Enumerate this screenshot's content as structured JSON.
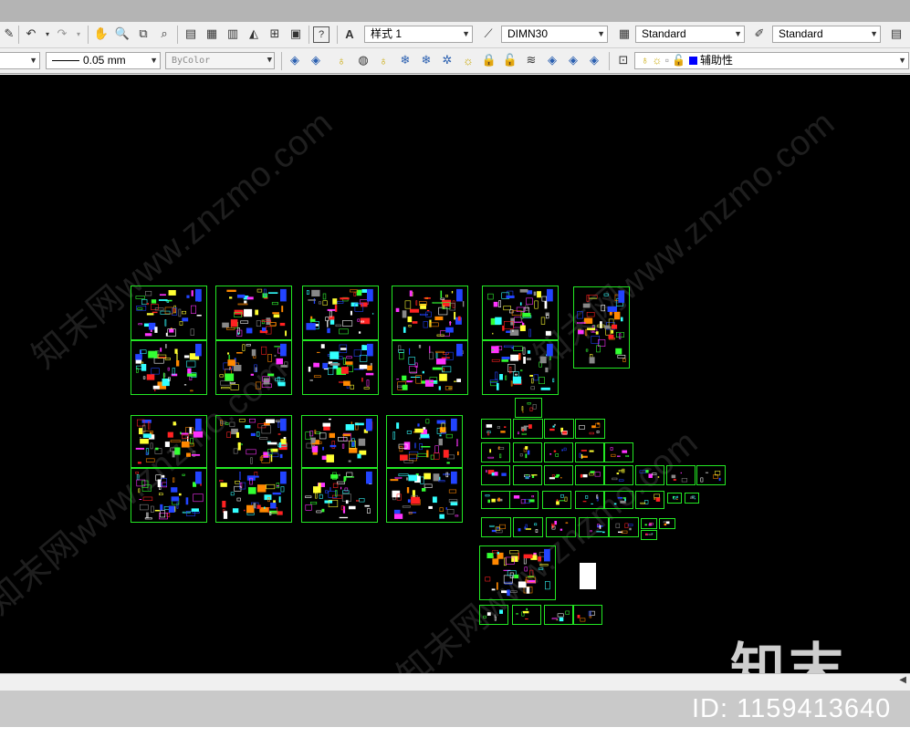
{
  "toolbar1": {
    "text_style": "样式 1",
    "dim_style": "DIMN30",
    "table_style": "Standard",
    "mleader_style": "Standard"
  },
  "toolbar2": {
    "lineweight": "0.05 mm",
    "plotstyle": "ByColor",
    "layer_name": "辅助性",
    "layer_color": "#0000ff"
  },
  "canvas": {
    "background": "#000000",
    "frame_color": "#23e823",
    "watermark": "知末网www.znzmo.com"
  },
  "overlay": {
    "logo": "知末",
    "id_label": "ID: 1159413640"
  }
}
